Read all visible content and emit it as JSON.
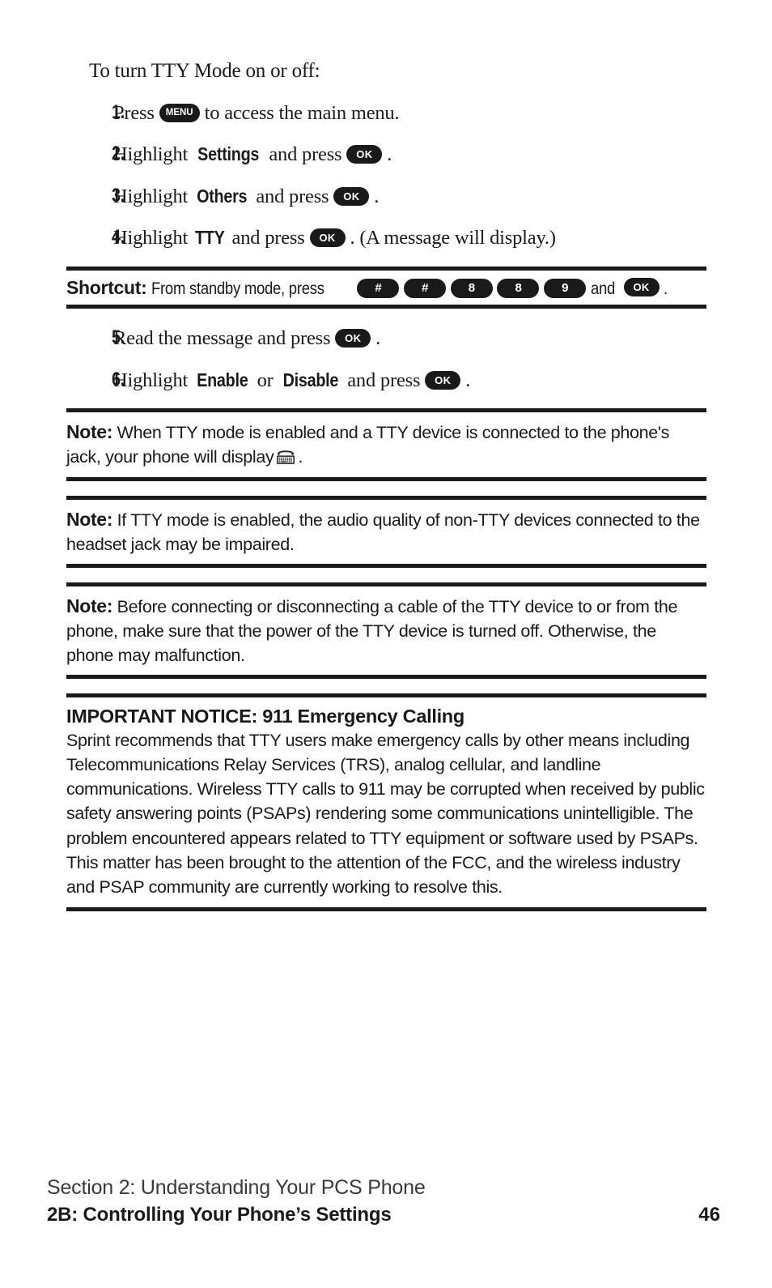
{
  "document": {
    "intro_line": "To turn TTY Mode on or off:"
  },
  "steps": [
    {
      "number": "1.",
      "before": "Press",
      "key": "MENU",
      "after": "to access the main menu."
    },
    {
      "number": "2.",
      "before": "Highlight",
      "bold_term": "Settings",
      "mid": "and press",
      "key": "OK",
      "after": "."
    },
    {
      "number": "3.",
      "before": "Highlight",
      "bold_term": "Others",
      "mid": "and press",
      "key": "OK",
      "after": "."
    },
    {
      "number": "4.",
      "before": "Highlight",
      "bold_term": "TTY",
      "mid": "and press",
      "key": "OK",
      "after": ". (A message will display.)"
    },
    {
      "number": "5.",
      "before": "Read the message and press",
      "key": "OK",
      "after": "."
    },
    {
      "number": "6.",
      "before": "Highlight",
      "bold_term": "Enable",
      "conjunction": "or",
      "bold_term2": "Disable",
      "mid": "and press",
      "key": "OK",
      "after": "."
    }
  ],
  "shortcut": {
    "label": "Shortcut:",
    "text_before": "From standby mode, press",
    "keys": [
      "#",
      "#",
      "8",
      "8",
      "9"
    ],
    "text_and": "and",
    "final_key": "OK",
    "text_after": "."
  },
  "notes": [
    {
      "label": "Note:",
      "text_part1": "When TTY mode is enabled and a TTY device is connected to the phone's jack, your phone will display",
      "icon": "tty-device-icon",
      "text_part2": "."
    },
    {
      "label": "Note:",
      "text_part1": "If TTY mode is enabled, the audio quality of non-TTY devices connected to the headset jack may be impaired.",
      "icon": null,
      "text_part2": ""
    },
    {
      "label": "Note:",
      "text_part1": "Before connecting or disconnecting a cable of the TTY device to or from the phone, make sure that the power of the TTY device is turned off. Otherwise, the phone may malfunction.",
      "icon": null,
      "text_part2": ""
    }
  ],
  "notice": {
    "title": "IMPORTANT NOTICE: 911 Emergency Calling",
    "body": "Sprint recommends that TTY users make emergency calls by other means including Telecommunications Relay Services (TRS), analog cellular, and landline communications. Wireless TTY calls to 911 may be corrupted when received by public safety answering points (PSAPs) rendering some communications unintelligible. The problem encountered appears related to TTY equipment or software used by PSAPs. This matter has been brought to the attention of the FCC, and the wireless industry and PSAP community are currently working to resolve this."
  },
  "footer": {
    "section": "Section 2: Understanding Your PCS Phone",
    "chapter": "2B: Controlling Your Phone’s Settings",
    "page_number": "46"
  },
  "colors": {
    "ink": "#1a1a1a",
    "paper": "#ffffff",
    "footer_section": "#3a3a3a"
  }
}
